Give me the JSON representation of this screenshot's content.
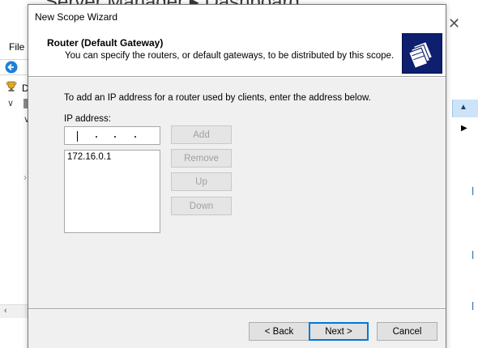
{
  "background_window": {
    "title": "Server Manager ▸ Dashboard",
    "close_glyph": "✕",
    "menu": {
      "file": "File"
    },
    "tree": {
      "first_item_initial": "D"
    }
  },
  "wizard": {
    "title": "New Scope Wizard",
    "heading": "Router (Default Gateway)",
    "subheading": "You can specify the routers, or default gateways, to be distributed by this scope.",
    "instructions": "To add an IP address for a router used by clients, enter the address below.",
    "ip_label": "IP address:",
    "ip_input_value": "",
    "router_list": [
      "172.16.0.1"
    ],
    "buttons": {
      "add": "Add",
      "remove": "Remove",
      "up": "Up",
      "down": "Down",
      "back": "< Back",
      "next": "Next >",
      "cancel": "Cancel"
    }
  },
  "icons": {
    "wizard_logo": "folders-icon",
    "back_arrow": "back-arrow-icon",
    "tree_root": "trophy-server-icon"
  },
  "colors": {
    "dialog_bg": "#f0f0f0",
    "logo_bg": "#0d1f6e",
    "default_button_border": "#0078d7",
    "disabled_text": "#a0a0a0",
    "selection_blue": "#cde3f7"
  }
}
